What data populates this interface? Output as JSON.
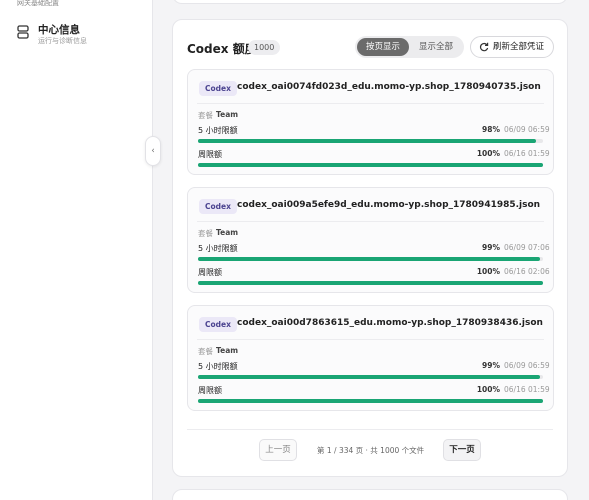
{
  "sidebar": {
    "prev_subtitle": "网关基础配置",
    "item": {
      "title": "中心信息",
      "subtitle": "运行与诊断信息"
    }
  },
  "panel": {
    "title": "Codex 额度",
    "count": "1000",
    "view_toggle": {
      "paged": "按页显示",
      "all": "显示全部",
      "selected": "paged"
    },
    "refresh_label": "刷新全部凭证"
  },
  "cards": [
    {
      "badge": "Codex",
      "name": "codex_oai0074fd023d_edu.momo-yp.shop_1780940735.json",
      "plan_label": "套餐",
      "plan": "Team",
      "quotas": [
        {
          "label": "5 小时限额",
          "percent": "98%",
          "fill": 0.98,
          "reset": "06/09 06:59"
        },
        {
          "label": "周限额",
          "percent": "100%",
          "fill": 1.0,
          "reset": "06/16 01:59"
        }
      ]
    },
    {
      "badge": "Codex",
      "name": "codex_oai009a5efe9d_edu.momo-yp.shop_1780941985.json",
      "plan_label": "套餐",
      "plan": "Team",
      "quotas": [
        {
          "label": "5 小时限额",
          "percent": "99%",
          "fill": 0.99,
          "reset": "06/09 07:06"
        },
        {
          "label": "周限额",
          "percent": "100%",
          "fill": 1.0,
          "reset": "06/16 02:06"
        }
      ]
    },
    {
      "badge": "Codex",
      "name": "codex_oai00d7863615_edu.momo-yp.shop_1780938436.json",
      "plan_label": "套餐",
      "plan": "Team",
      "quotas": [
        {
          "label": "5 小时限额",
          "percent": "99%",
          "fill": 0.99,
          "reset": "06/09 06:59"
        },
        {
          "label": "周限额",
          "percent": "100%",
          "fill": 1.0,
          "reset": "06/16 01:59"
        }
      ]
    }
  ],
  "pager": {
    "prev": "上一页",
    "info": "第 1 / 334 页 · 共 1000 个文件",
    "next": "下一页"
  },
  "colors": {
    "accent": "#1aa574",
    "badge_bg": "#ebe8f7",
    "badge_fg": "#4b4390",
    "toggle_active": "#6b6b6b"
  },
  "icons": {
    "sidebar_item": "server-icon",
    "refresh": "refresh-icon",
    "collapse": "chevron-left-icon"
  }
}
